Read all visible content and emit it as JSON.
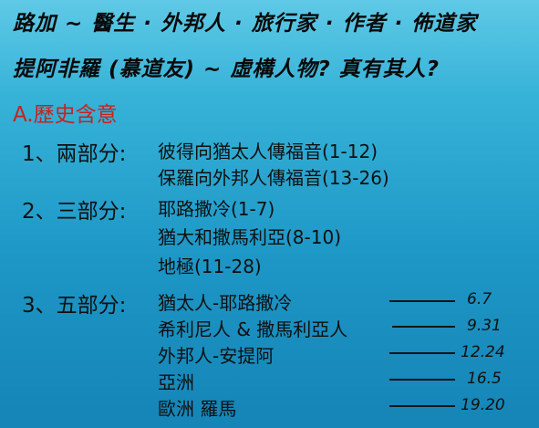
{
  "header": {
    "line1": "路加 ~ 醫生 · 外邦人 · 旅行家 · 作者 · 佈道家",
    "line2": "提阿非羅 (慕道友) ~ 虛構人物? 真有其人?"
  },
  "section": {
    "title": "A.歷史含意"
  },
  "two_parts": {
    "label": "1、兩部分:",
    "items": [
      "彼得向猶太人傳福音(1-12)",
      "保羅向外邦人傳福音(13-26)"
    ]
  },
  "three_parts": {
    "label": "2、三部分:",
    "items": [
      "耶路撒冷(1-7)",
      "猶大和撒馬利亞(8-10)",
      "地極(11-28)"
    ]
  },
  "five_parts": {
    "label": "3、五部分:",
    "items": [
      {
        "name": "猶太人-耶路撒冷",
        "ref": "6.7"
      },
      {
        "name": "希利尼人 & 撒馬利亞人",
        "ref": "9.31"
      },
      {
        "name": "外邦人-安提阿",
        "ref": "12.24"
      },
      {
        "name": "亞洲",
        "ref": "16.5"
      },
      {
        "name": "歐洲  羅馬",
        "ref": "19.20"
      }
    ]
  }
}
